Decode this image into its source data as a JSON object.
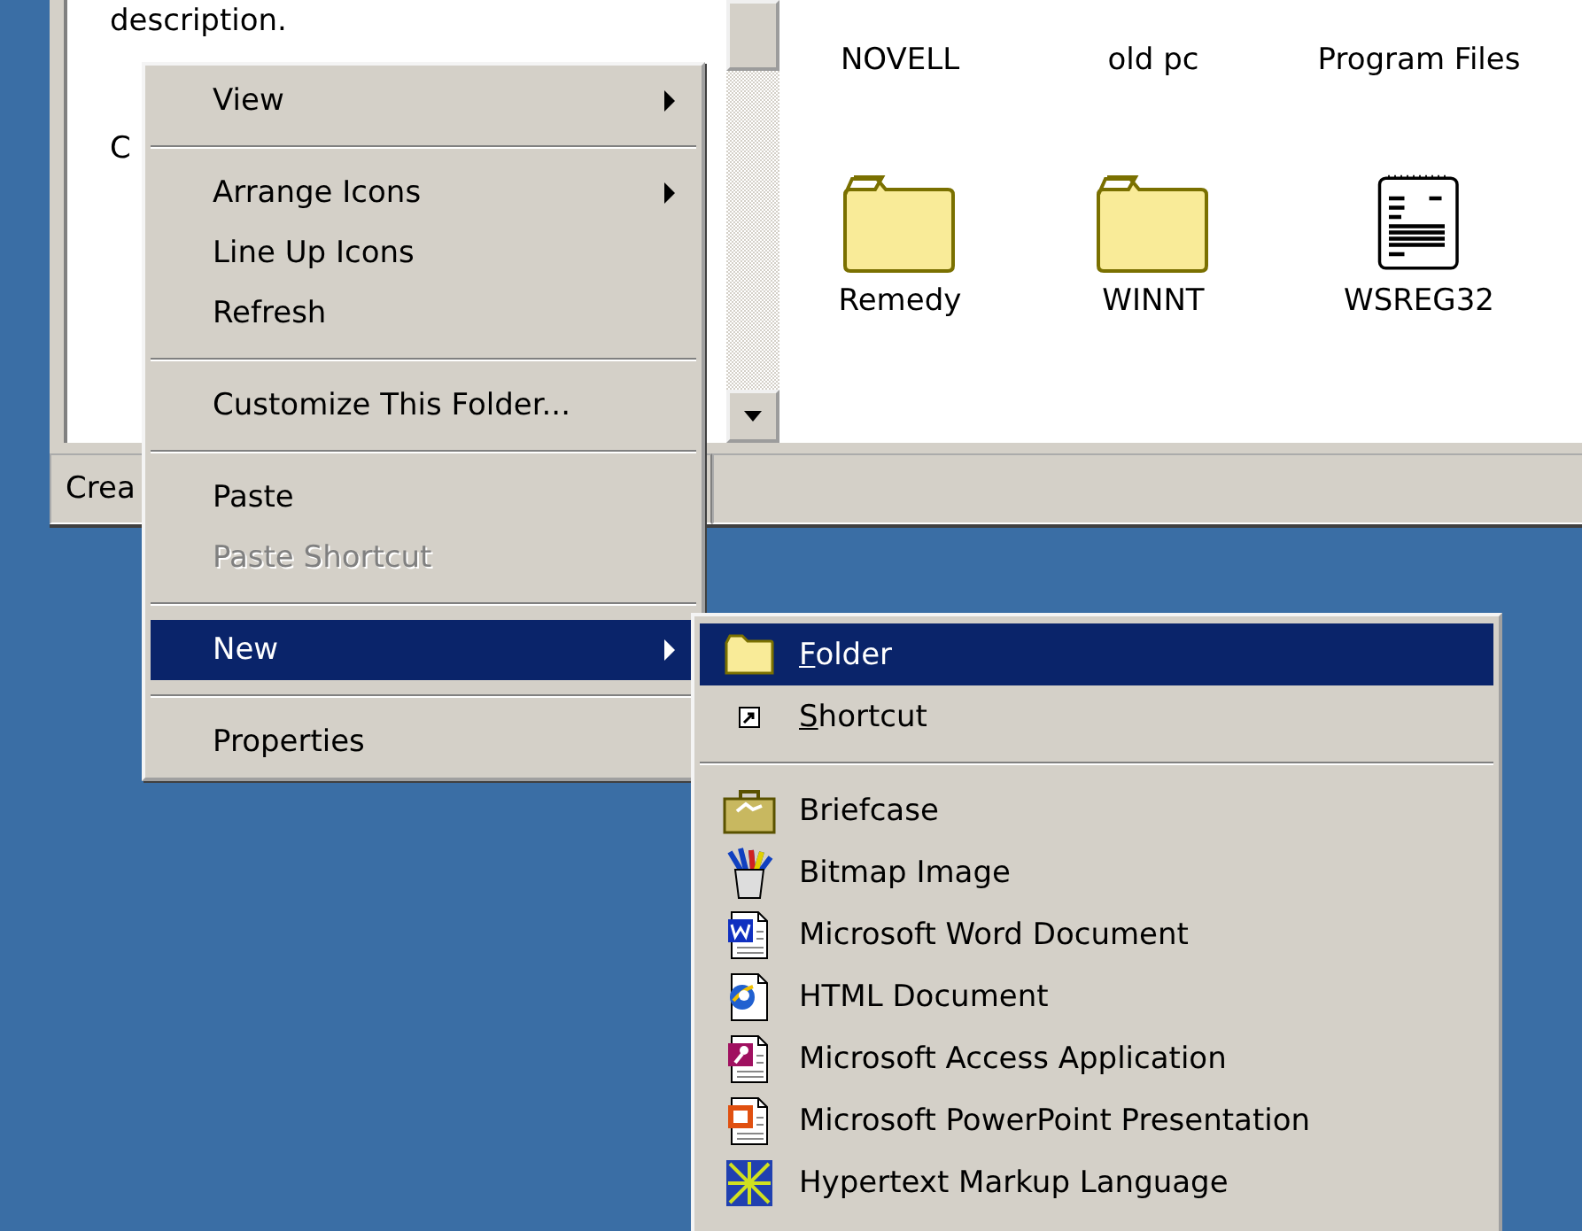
{
  "explorer_window": {
    "left_pane": {
      "texts": [
        "description.",
        "C"
      ]
    },
    "items": [
      {
        "kind": "label",
        "name": "NOVELL"
      },
      {
        "kind": "label",
        "name": "old pc"
      },
      {
        "kind": "label",
        "name": "Program Files"
      },
      {
        "kind": "folder",
        "name": "Remedy"
      },
      {
        "kind": "folder",
        "name": "WINNT"
      },
      {
        "kind": "notepad",
        "name": "WSREG32"
      }
    ],
    "status_bar": "Crea"
  },
  "context_menu": {
    "items": [
      {
        "kind": "item",
        "label": "View",
        "submenu": true,
        "selected": false,
        "disabled": false
      },
      {
        "kind": "separator"
      },
      {
        "kind": "item",
        "label": "Arrange Icons",
        "submenu": true,
        "selected": false,
        "disabled": false
      },
      {
        "kind": "item",
        "label": "Line Up Icons",
        "submenu": false,
        "selected": false,
        "disabled": false
      },
      {
        "kind": "item",
        "label": "Refresh",
        "submenu": false,
        "selected": false,
        "disabled": false
      },
      {
        "kind": "separator"
      },
      {
        "kind": "item",
        "label": "Customize This Folder...",
        "submenu": false,
        "selected": false,
        "disabled": false
      },
      {
        "kind": "separator"
      },
      {
        "kind": "item",
        "label": "Paste",
        "submenu": false,
        "selected": false,
        "disabled": false
      },
      {
        "kind": "item",
        "label": "Paste Shortcut",
        "submenu": false,
        "selected": false,
        "disabled": true
      },
      {
        "kind": "separator"
      },
      {
        "kind": "item",
        "label": "New",
        "submenu": true,
        "selected": true,
        "disabled": false
      },
      {
        "kind": "separator"
      },
      {
        "kind": "item",
        "label": "Properties",
        "submenu": false,
        "selected": false,
        "disabled": false
      }
    ]
  },
  "new_submenu": {
    "items": [
      {
        "kind": "folder",
        "label": "Folder",
        "first_letter_underlined": true,
        "selected": true
      },
      {
        "kind": "shortcut",
        "label": "Shortcut",
        "first_letter_underlined": true,
        "selected": false
      },
      {
        "kind": "separator"
      },
      {
        "kind": "briefcase",
        "label": "Briefcase",
        "selected": false
      },
      {
        "kind": "bitmap",
        "label": "Bitmap Image",
        "selected": false
      },
      {
        "kind": "word",
        "label": "Microsoft Word Document",
        "selected": false
      },
      {
        "kind": "html",
        "label": "HTML Document",
        "selected": false
      },
      {
        "kind": "access",
        "label": "Microsoft Access Application",
        "selected": false
      },
      {
        "kind": "powerpoint",
        "label": "Microsoft PowerPoint Presentation",
        "selected": false
      },
      {
        "kind": "hypertext",
        "label": "Hypertext Markup Language",
        "selected": false
      }
    ]
  }
}
